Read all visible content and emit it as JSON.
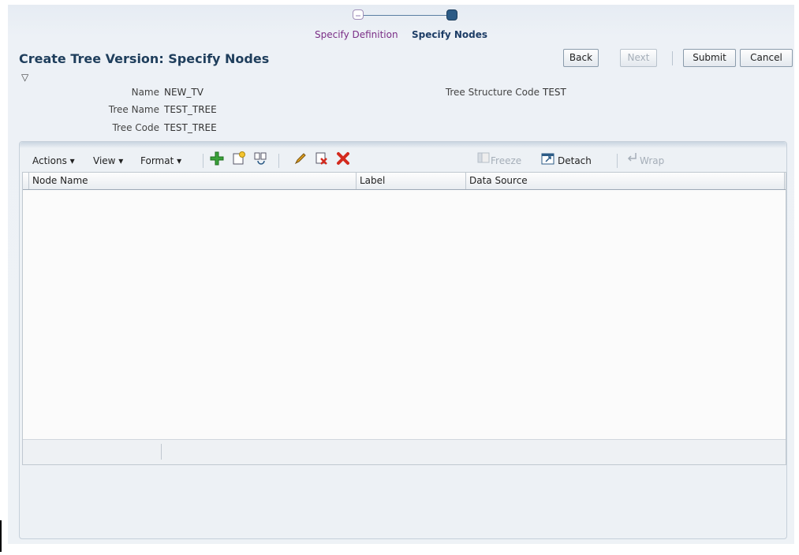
{
  "train": {
    "step1": "Specify Definition",
    "step2": "Specify Nodes"
  },
  "header": {
    "title": "Create Tree Version: Specify Nodes",
    "disclosure_glyph": "▽"
  },
  "buttons": {
    "back": "Back",
    "next": "Next",
    "submit": "Submit",
    "cancel": "Cancel"
  },
  "fields": {
    "name_label": "Name",
    "name_value": "NEW_TV",
    "tree_name_label": "Tree Name",
    "tree_name_value": "TEST_TREE",
    "tree_code_label": "Tree Code",
    "tree_code_value": "TEST_TREE",
    "structure_code_label": "Tree Structure Code",
    "structure_code_value": "TEST"
  },
  "toolbar": {
    "actions": "Actions ▾",
    "view": "View ▾",
    "format": "Format ▾",
    "freeze": "Freeze",
    "detach": "Detach",
    "wrap": "Wrap",
    "icons": [
      "add-icon",
      "create-child-icon",
      "insert-icon",
      "edit-icon",
      "delete-row-icon",
      "remove-icon"
    ]
  },
  "table": {
    "columns": [
      "Node Name",
      "Label",
      "Data Source"
    ],
    "rows": []
  },
  "colors": {
    "title": "#1f3e5c",
    "step_visited": "#7a2e86",
    "step_current": "#1d3d66",
    "add_icon": "#3aa23a",
    "delete_icon": "#d32a1e"
  }
}
